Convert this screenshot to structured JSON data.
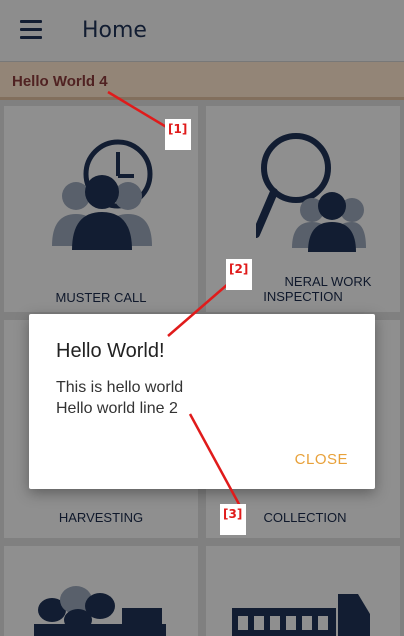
{
  "appbar": {
    "title": "Home",
    "menu_icon": "hamburger-menu-icon"
  },
  "banner": {
    "text": "Hello World 4"
  },
  "tiles": [
    {
      "label": "MUSTER CALL",
      "icon": "muster-clock-group-icon"
    },
    {
      "label": "GENERAL WORK INSPECTION",
      "label_line1": "NERAL WORK",
      "label_line2": "INSPECTION",
      "icon": "magnifier-group-icon"
    },
    {
      "label": "HARVESTING",
      "icon": "harvesting-icon"
    },
    {
      "label": "COLLECTION",
      "icon": "collection-icon"
    },
    {
      "label": "",
      "icon": "fruit-truck-icon"
    },
    {
      "label": "",
      "icon": "truck-icon"
    }
  ],
  "dialog": {
    "title": "Hello World!",
    "line1": "This is hello world",
    "line2": "Hello world line 2",
    "close_label": "CLOSE"
  },
  "markers": [
    "[1]",
    "[2]",
    "[3]"
  ],
  "colors": {
    "accent": "#e8a13a",
    "navy": "#1f3356",
    "banner": "#fde6cd",
    "annotation": "#e01b1b"
  }
}
